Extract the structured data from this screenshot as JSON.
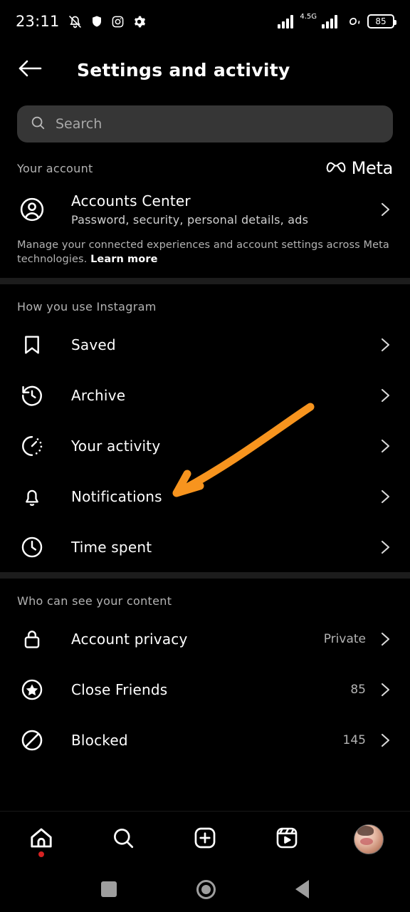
{
  "status_bar": {
    "time": "23:11",
    "left_icons": [
      "bell-muted-icon",
      "shield-icon",
      "instagram-icon",
      "gear-icon"
    ],
    "network_label": "4.5G",
    "right_icons": [
      "signal-bars-icon",
      "signal-bars-icon",
      "data-saver-icon"
    ],
    "battery_level": "85"
  },
  "header": {
    "back_icon": "back-arrow-icon",
    "title": "Settings and activity"
  },
  "search": {
    "icon": "search-icon",
    "placeholder": "Search"
  },
  "account_section": {
    "title": "Your account",
    "brand": "Meta",
    "brand_icon": "meta-infinity-icon",
    "row": {
      "icon": "account-circle-icon",
      "label": "Accounts Center",
      "sub": "Password, security, personal details, ads",
      "chevron": "chevron-right-icon"
    },
    "note": "Manage your connected experiences and account settings across Meta technologies.",
    "note_link": "Learn more"
  },
  "how_you_use": {
    "title": "How you use Instagram",
    "rows": [
      {
        "icon": "bookmark-icon",
        "label": "Saved",
        "value": "",
        "chevron": "chevron-right-icon"
      },
      {
        "icon": "archive-clock-icon",
        "label": "Archive",
        "value": "",
        "chevron": "chevron-right-icon"
      },
      {
        "icon": "activity-clock-icon",
        "label": "Your activity",
        "value": "",
        "chevron": "chevron-right-icon"
      },
      {
        "icon": "bell-icon",
        "label": "Notifications",
        "value": "",
        "chevron": "chevron-right-icon"
      },
      {
        "icon": "clock-icon",
        "label": "Time spent",
        "value": "",
        "chevron": "chevron-right-icon"
      }
    ]
  },
  "who_can_see": {
    "title": "Who can see your content",
    "rows": [
      {
        "icon": "lock-icon",
        "label": "Account privacy",
        "value": "Private",
        "chevron": "chevron-right-icon"
      },
      {
        "icon": "star-circle-icon",
        "label": "Close Friends",
        "value": "85",
        "chevron": "chevron-right-icon"
      },
      {
        "icon": "blocked-icon",
        "label": "Blocked",
        "value": "145",
        "chevron": "chevron-right-icon"
      }
    ]
  },
  "annotation": {
    "type": "arrow",
    "color": "#F7941E",
    "points_to": "Your activity"
  },
  "bottom_nav": [
    {
      "icon": "home-icon",
      "badge": true
    },
    {
      "icon": "search-icon",
      "badge": false
    },
    {
      "icon": "create-plus-icon",
      "badge": false
    },
    {
      "icon": "reels-icon",
      "badge": false
    },
    {
      "icon": "profile-avatar",
      "badge": false
    }
  ],
  "android_nav": [
    {
      "icon": "recents-icon"
    },
    {
      "icon": "home-circle-icon"
    },
    {
      "icon": "back-triangle-icon"
    }
  ]
}
